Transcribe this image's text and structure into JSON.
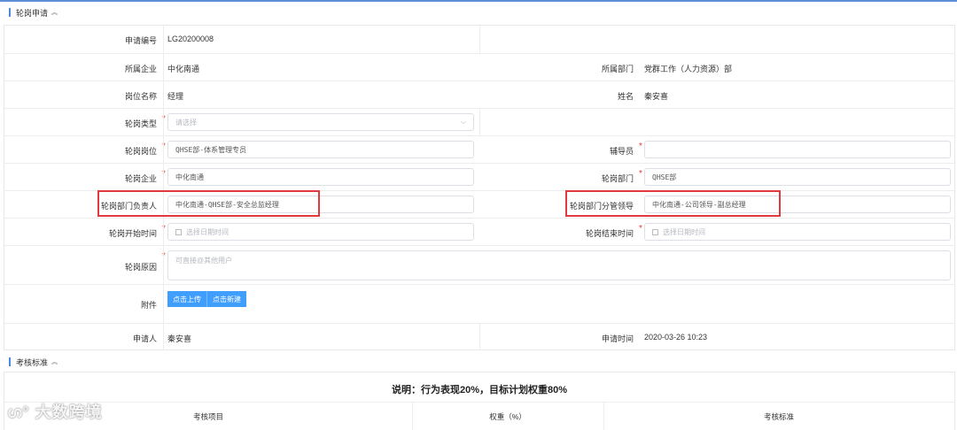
{
  "section1": {
    "title": "轮岗申请",
    "chev": "︽"
  },
  "section2": {
    "title": "考核标准",
    "chev": "︽"
  },
  "form": {
    "apply_no_label": "申请编号",
    "apply_no": "LG20200008",
    "company_label": "所属企业",
    "company": "中化南通",
    "dept_label": "所属部门",
    "dept": "党群工作（人力资源）部",
    "post_label": "岗位名称",
    "post": "经理",
    "name_label": "姓名",
    "name": "秦安喜",
    "rot_type_label": "轮岗类型",
    "rot_type_ph": "请选择",
    "rot_post_label": "轮岗岗位",
    "rot_post": "QHSE部-体系管理专员",
    "mentor_label": "辅导员",
    "mentor": "",
    "rot_company_label": "轮岗企业",
    "rot_company": "中化南通",
    "rot_dept_label": "轮岗部门",
    "rot_dept": "QHSE部",
    "rot_head_label": "轮岗部门负责人",
    "rot_head": "中化南通-QHSE部-安全总监经理",
    "rot_leader_label": "轮岗部门分管领导",
    "rot_leader": "中化南通-公司领导-副总经理",
    "start_label": "轮岗开始时间",
    "start_ph": "选择日期时间",
    "end_label": "轮岗结束时间",
    "end_ph": "选择日期时间",
    "reason_label": "轮岗原因",
    "reason_ph": "可直接@其他用户",
    "attach_label": "附件",
    "upload_btn": "点击上传",
    "new_btn": "点击新建",
    "applicant_label": "申请人",
    "applicant": "秦安喜",
    "apply_time_label": "申请时间",
    "apply_time": "2020-03-26 10:23"
  },
  "assessment": {
    "note": "说明：行为表现20%，目标计划权重80%",
    "columns": [
      "考核项目",
      "权重（%）",
      "考核标准"
    ]
  },
  "watermark": "大数跨境",
  "colors": {
    "accent": "#409eff",
    "required": "#e53935",
    "highlight": "#e0393e"
  }
}
